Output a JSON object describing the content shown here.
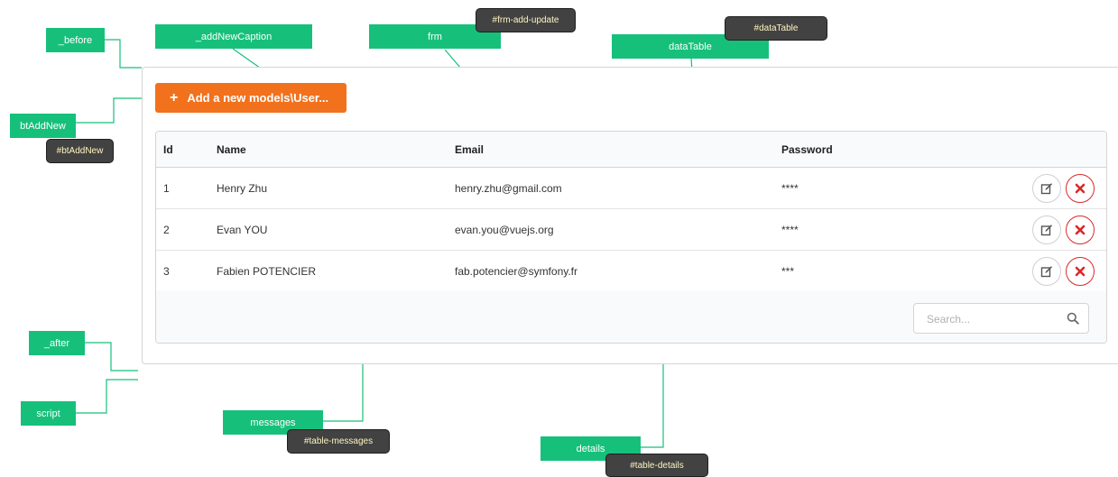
{
  "annotations": {
    "before": "_before",
    "add_new_caption": "_addNewCaption",
    "frm": "frm",
    "frm_id": "#frm-add-update",
    "data_table": "dataTable",
    "data_table_id": "#dataTable",
    "bt_add_new": "btAddNew",
    "bt_add_new_id": "#btAddNew",
    "after": "_after",
    "script": "script",
    "messages": "messages",
    "messages_id": "#table-messages",
    "details": "details",
    "details_id": "#table-details"
  },
  "add_button": {
    "label": "Add a new models\\User..."
  },
  "table": {
    "columns": [
      "Id",
      "Name",
      "Email",
      "Password"
    ],
    "rows": [
      {
        "id": "1",
        "name": "Henry Zhu",
        "email": "henry.zhu@gmail.com",
        "password": "****"
      },
      {
        "id": "2",
        "name": "Evan YOU",
        "email": "evan.you@vuejs.org",
        "password": "****"
      },
      {
        "id": "3",
        "name": "Fabien POTENCIER",
        "email": "fab.potencier@symfony.fr",
        "password": "***"
      }
    ]
  },
  "search": {
    "placeholder": "Search..."
  },
  "icons": {
    "add": "plus-icon",
    "edit": "edit-icon",
    "delete": "delete-icon",
    "search": "search-icon"
  },
  "colors": {
    "annotation_green": "#16c07b",
    "annotation_dark": "#424242",
    "add_button": "#f2711c",
    "delete_red": "#db2828"
  }
}
